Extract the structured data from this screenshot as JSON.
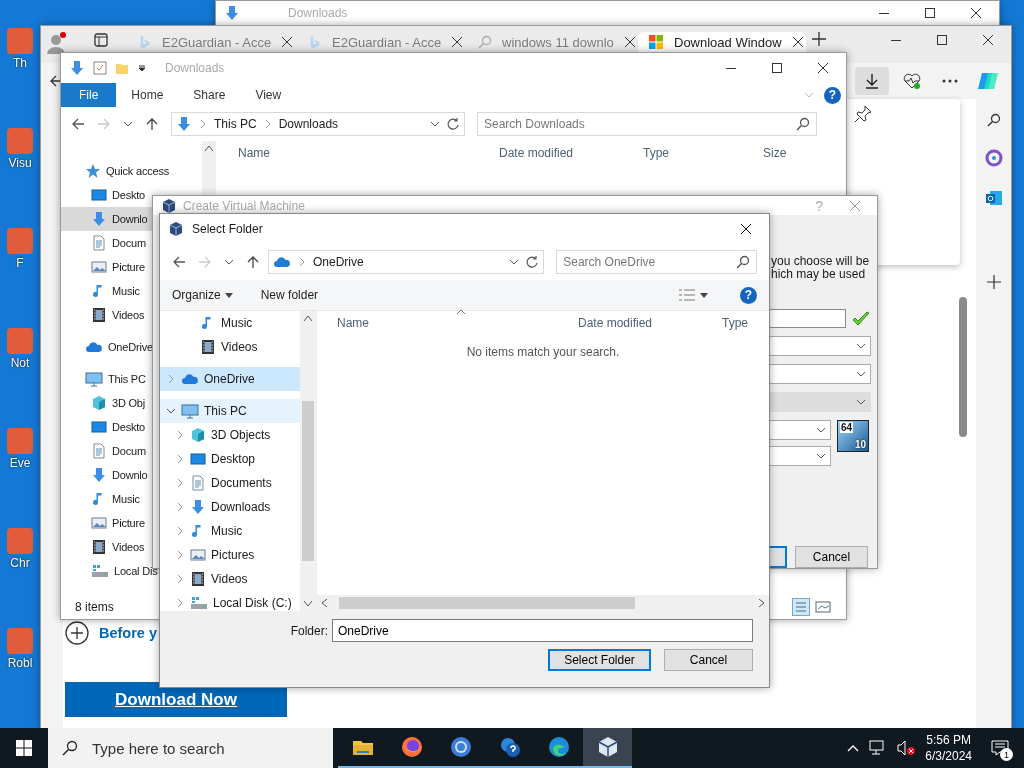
{
  "desktop": {
    "icons": [
      {
        "label": "Th"
      },
      {
        "label": "Visu"
      },
      {
        "label": "F"
      },
      {
        "label": "Not"
      },
      {
        "label": "Eve"
      },
      {
        "label": "Chr"
      },
      {
        "label": "Robl"
      }
    ]
  },
  "back_window": {
    "title": "Downloads"
  },
  "browser": {
    "tabs": [
      {
        "title": "E2Guardian - Acce",
        "kind": "bing",
        "selected": false
      },
      {
        "title": "E2Guardian - Acce",
        "kind": "bing",
        "selected": false
      },
      {
        "title": "windows 11 downlo",
        "kind": "search",
        "selected": false
      },
      {
        "title": "Download Window",
        "kind": "microsoft",
        "selected": true
      }
    ],
    "page": {
      "expander_text": "Before y",
      "download_button": "Download Now"
    }
  },
  "explorer": {
    "title": "Downloads",
    "help_glyph": "?",
    "ribbon_tabs": [
      {
        "label": "File",
        "selected": true
      },
      {
        "label": "Home",
        "selected": false
      },
      {
        "label": "Share",
        "selected": false
      },
      {
        "label": "View",
        "selected": false
      }
    ],
    "path": [
      "This PC",
      "Downloads"
    ],
    "search_placeholder": "Search Downloads",
    "columns": [
      "Name",
      "Date modified",
      "Type",
      "Size"
    ],
    "nav": [
      {
        "label": "Quick access",
        "kind": "star",
        "selected": false,
        "children": [
          {
            "label": "Deskto",
            "kind": "desktop",
            "selected": false
          },
          {
            "label": "Downlo",
            "kind": "download",
            "selected": true
          },
          {
            "label": "Docum",
            "kind": "document",
            "selected": false
          },
          {
            "label": "Picture",
            "kind": "pictures",
            "selected": false
          },
          {
            "label": "Music",
            "kind": "music",
            "selected": false
          },
          {
            "label": "Videos",
            "kind": "videos",
            "selected": false
          }
        ]
      },
      {
        "label": "OneDrive",
        "kind": "cloud",
        "selected": false
      },
      {
        "label": "This PC",
        "kind": "pc",
        "selected": false,
        "children": [
          {
            "label": "3D Obj",
            "kind": "cube",
            "selected": false
          },
          {
            "label": "Deskto",
            "kind": "desktop",
            "selected": false
          },
          {
            "label": "Docum",
            "kind": "document",
            "selected": false
          },
          {
            "label": "Downlo",
            "kind": "download",
            "selected": false
          },
          {
            "label": "Music",
            "kind": "music",
            "selected": false
          },
          {
            "label": "Picture",
            "kind": "pictures",
            "selected": false
          },
          {
            "label": "Videos",
            "kind": "videos",
            "selected": false
          },
          {
            "label": "Local Dis",
            "kind": "disk",
            "selected": false
          }
        ]
      }
    ],
    "status": "8 items"
  },
  "vm_dialog": {
    "title": "Create Virtual Machine",
    "help_glyph": "?",
    "description_lines": [
      "you choose will be",
      "hich may be used"
    ],
    "os_badge": [
      "64",
      "10"
    ],
    "cancel_button": "Cancel"
  },
  "select_folder": {
    "title": "Select Folder",
    "path": [
      "OneDrive"
    ],
    "search_placeholder": "Search OneDrive",
    "toolbar": {
      "organize": "Organize",
      "new_folder": "New folder",
      "help_glyph": "?"
    },
    "quick_access_tail": [
      {
        "label": "Music",
        "kind": "music",
        "selected": false,
        "hovered": false
      },
      {
        "label": "Videos",
        "kind": "videos",
        "selected": false,
        "hovered": false
      }
    ],
    "tree": [
      {
        "label": "OneDrive",
        "kind": "cloud",
        "expanded": false,
        "selected": true,
        "hovered": false
      },
      {
        "label": "This PC",
        "kind": "pc",
        "expanded": true,
        "selected": false,
        "hovered": true,
        "children": [
          {
            "label": "3D Objects",
            "kind": "cube",
            "expanded": false,
            "selected": false,
            "hovered": false
          },
          {
            "label": "Desktop",
            "kind": "desktop",
            "expanded": false,
            "selected": false,
            "hovered": false
          },
          {
            "label": "Documents",
            "kind": "document",
            "expanded": false,
            "selected": false,
            "hovered": false
          },
          {
            "label": "Downloads",
            "kind": "download",
            "expanded": false,
            "selected": false,
            "hovered": false
          },
          {
            "label": "Music",
            "kind": "music",
            "expanded": false,
            "selected": false,
            "hovered": false
          },
          {
            "label": "Pictures",
            "kind": "pictures",
            "expanded": false,
            "selected": false,
            "hovered": false
          },
          {
            "label": "Videos",
            "kind": "videos",
            "expanded": false,
            "selected": false,
            "hovered": false
          },
          {
            "label": "Local Disk (C:)",
            "kind": "disk",
            "expanded": false,
            "selected": false,
            "hovered": false
          }
        ]
      }
    ],
    "columns": [
      "Name",
      "Date modified",
      "Type"
    ],
    "empty_message": "No items match your search.",
    "folder_label": "Folder:",
    "folder_value": "OneDrive",
    "buttons": [
      {
        "label": "Select Folder",
        "default": true
      },
      {
        "label": "Cancel",
        "default": false
      }
    ]
  },
  "taskbar": {
    "search_placeholder": "Type here to search",
    "apps": [
      {
        "kind": "files",
        "selected": false
      },
      {
        "kind": "firefox",
        "selected": false
      },
      {
        "kind": "chrome",
        "selected": false
      },
      {
        "kind": "help",
        "selected": false
      },
      {
        "kind": "edge",
        "selected": false
      },
      {
        "kind": "virtualbox",
        "selected": true
      }
    ],
    "time": "5:56 PM",
    "date": "6/3/2024",
    "notification_count": "1"
  }
}
